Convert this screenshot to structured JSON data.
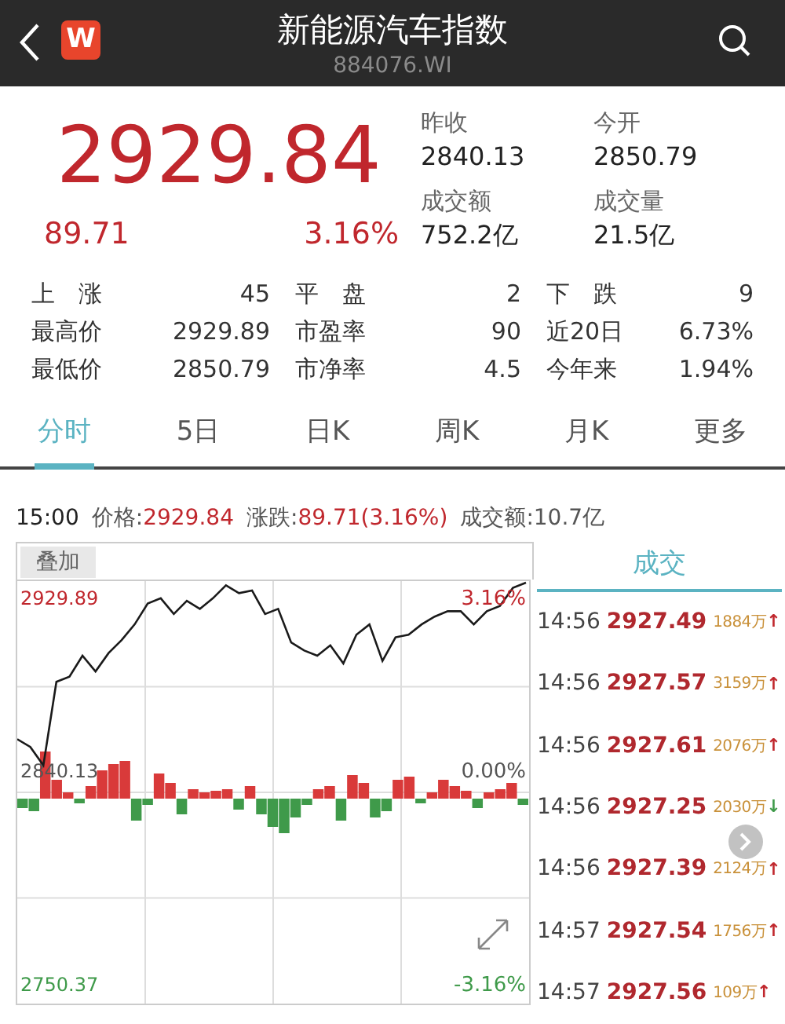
{
  "header": {
    "title": "新能源汽车指数",
    "code": "884076.WI",
    "logo": "W"
  },
  "quote": {
    "price": "2929.84",
    "change": "89.71",
    "change_pct": "3.16%"
  },
  "summary": [
    {
      "label": "昨收",
      "value": "2840.13"
    },
    {
      "label": "今开",
      "value": "2850.79"
    },
    {
      "label": "成交额",
      "value": "752.2亿"
    },
    {
      "label": "成交量",
      "value": "21.5亿"
    }
  ],
  "stats": [
    [
      {
        "label": "上　涨",
        "value": "45"
      },
      {
        "label": "平　盘",
        "value": "2"
      },
      {
        "label": "下　跌",
        "value": "9"
      }
    ],
    [
      {
        "label": "最高价",
        "value": "2929.89"
      },
      {
        "label": "市盈率",
        "value": "90"
      },
      {
        "label": "近20日",
        "value": "6.73%"
      }
    ],
    [
      {
        "label": "最低价",
        "value": "2850.79"
      },
      {
        "label": "市净率",
        "value": "4.5"
      },
      {
        "label": "今年来",
        "value": "1.94%"
      }
    ]
  ],
  "tabs": [
    {
      "label": "分时",
      "selected": true
    },
    {
      "label": "5日",
      "selected": false
    },
    {
      "label": "日K",
      "selected": false
    },
    {
      "label": "周K",
      "selected": false
    },
    {
      "label": "月K",
      "selected": false
    },
    {
      "label": "更多",
      "selected": false
    }
  ],
  "info_bar": {
    "time": "15:00",
    "price_label": "价格:",
    "price": "2929.84",
    "change_label": "涨跌:",
    "change": "89.71(3.16%)",
    "amount": "成交额:10.7亿"
  },
  "overlay_button": "叠加",
  "chart": {
    "kind": "picture",
    "left_labels": [
      "2929.89",
      "2840.13",
      "2750.37"
    ],
    "right_labels": [
      "3.16%",
      "0.00%",
      "-3.16%"
    ]
  },
  "trades_title": "成交",
  "trades": [
    {
      "time": "14:56",
      "price": "2927.49",
      "volume": "1884万",
      "arrow": "↑",
      "kind": "up"
    },
    {
      "time": "14:56",
      "price": "2927.57",
      "volume": "3159万",
      "arrow": "↑",
      "kind": "up"
    },
    {
      "time": "14:56",
      "price": "2927.61",
      "volume": "2076万",
      "arrow": "↑",
      "kind": "up"
    },
    {
      "time": "14:56",
      "price": "2927.25",
      "volume": "2030万",
      "arrow": "↓",
      "kind": "down"
    },
    {
      "time": "14:56",
      "price": "2927.39",
      "volume": "2124万",
      "arrow": "↑",
      "kind": "up"
    },
    {
      "time": "14:57",
      "price": "2927.54",
      "volume": "1756万",
      "arrow": "↑",
      "kind": "up"
    },
    {
      "time": "14:57",
      "price": "2927.56",
      "volume": "109万",
      "arrow": "↑",
      "kind": "up"
    }
  ]
}
